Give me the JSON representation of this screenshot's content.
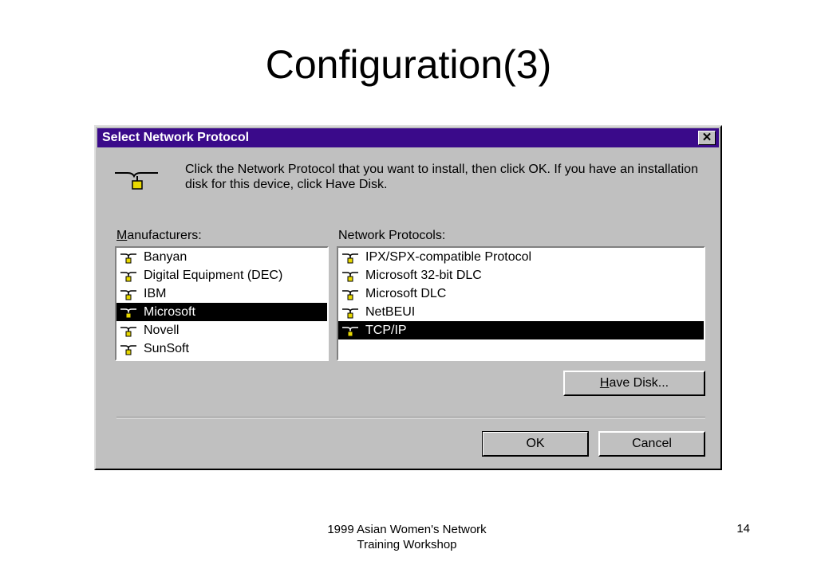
{
  "slide": {
    "title": "Configuration(3)",
    "footer_line1": "1999 Asian Women's Network",
    "footer_line2": "Training Workshop",
    "page_number": "14"
  },
  "dialog": {
    "title": "Select Network Protocol",
    "close_glyph": "✕",
    "instruction": "Click the Network Protocol that you want to install, then click OK. If you have an installation disk for this device, click Have Disk.",
    "manufacturers_label_hotkey": "M",
    "manufacturers_label_rest": "anufacturers:",
    "protocols_label": "Network Protocols:",
    "manufacturers": [
      {
        "label": "Banyan",
        "icon": "network-protocol-icon"
      },
      {
        "label": "Digital Equipment (DEC)",
        "icon": "network-protocol-icon"
      },
      {
        "label": "IBM",
        "icon": "network-protocol-icon"
      },
      {
        "label": "Microsoft",
        "icon": "network-protocol-icon",
        "selected": true
      },
      {
        "label": "Novell",
        "icon": "network-protocol-icon"
      },
      {
        "label": "SunSoft",
        "icon": "network-protocol-icon"
      }
    ],
    "protocols": [
      {
        "label": "IPX/SPX-compatible Protocol",
        "icon": "network-protocol-icon"
      },
      {
        "label": "Microsoft 32-bit DLC",
        "icon": "network-protocol-icon"
      },
      {
        "label": "Microsoft DLC",
        "icon": "network-protocol-icon"
      },
      {
        "label": "NetBEUI",
        "icon": "network-protocol-icon"
      },
      {
        "label": "TCP/IP",
        "icon": "network-protocol-icon",
        "selected": true
      }
    ],
    "have_disk_hotkey": "H",
    "have_disk_rest": "ave Disk...",
    "ok_label": "OK",
    "cancel_label": "Cancel"
  },
  "colors": {
    "titlebar": "#3a0a8a",
    "dialog_face": "#c0c0c0",
    "selection": "#000000",
    "icon_yellow": "#e8d800"
  }
}
